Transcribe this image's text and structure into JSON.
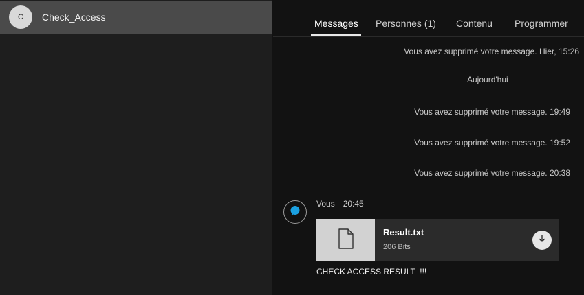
{
  "sidebar": {
    "conversations": [
      {
        "initial": "C",
        "name": "Check_Access"
      }
    ]
  },
  "tabs": [
    {
      "label": "Messages",
      "active": true
    },
    {
      "label": "Personnes (1)",
      "active": false
    },
    {
      "label": "Contenu",
      "active": false
    },
    {
      "label": "Programmer",
      "active": false
    }
  ],
  "chat": {
    "system_messages": [
      "Vous avez supprimé votre message. Hier, 15:26",
      "Vous avez supprimé votre message. 19:49",
      "Vous avez supprimé votre message. 19:52",
      "Vous avez supprimé votre message. 20:38"
    ],
    "day_separator": "Aujourd'hui",
    "message": {
      "author": "Vous",
      "time": "20:45",
      "file": {
        "name": "Result.txt",
        "size": "206 Bits"
      },
      "text": "CHECK ACCESS RESULT  !!!"
    }
  },
  "colors": {
    "accent_blue": "#1ba1e2",
    "selected_conversation": "#4a4a4a"
  },
  "icons": {
    "file": "file-icon",
    "download": "download-icon",
    "chat": "chat-bubble-icon"
  }
}
